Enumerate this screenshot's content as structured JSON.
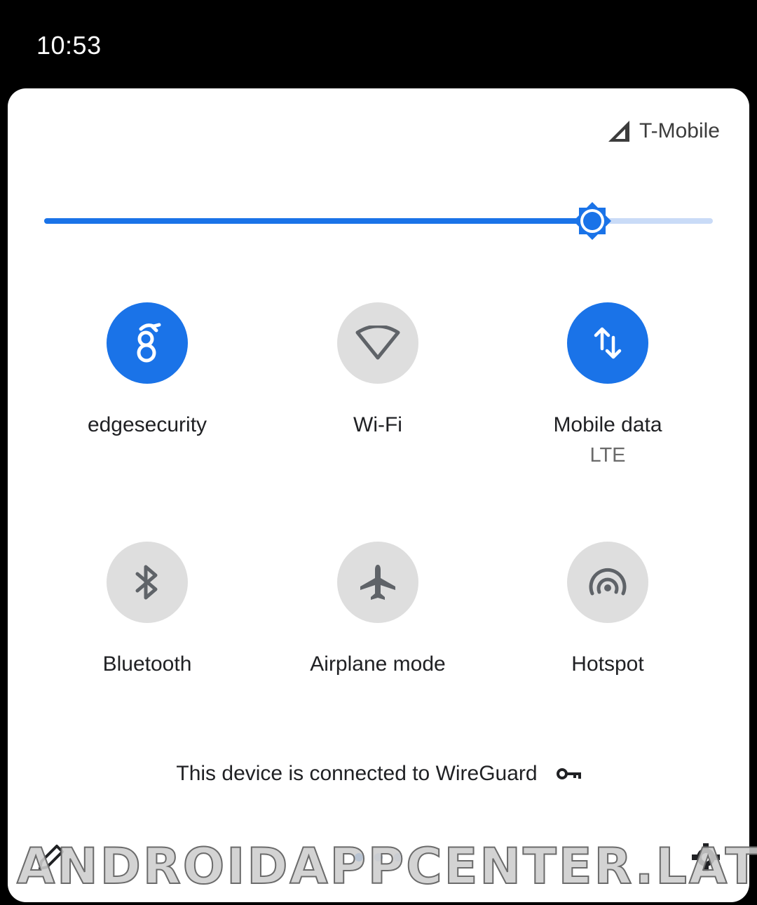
{
  "status_bar": {
    "time": "10:53"
  },
  "carrier": {
    "name": "T-Mobile"
  },
  "brightness": {
    "level": 0.82,
    "accent": "#1a73e8",
    "track_color": "#c9dbf7"
  },
  "tiles": [
    {
      "label": "edgesecurity",
      "icon": "wireguard-dragon-icon",
      "active": true
    },
    {
      "label": "Wi-Fi",
      "icon": "wifi-icon",
      "active": false
    },
    {
      "label": "Mobile data",
      "sublabel": "LTE",
      "icon": "mobile-data-icon",
      "active": true
    },
    {
      "label": "Bluetooth",
      "icon": "bluetooth-icon",
      "active": false
    },
    {
      "label": "Airplane mode",
      "icon": "airplane-icon",
      "active": false
    },
    {
      "label": "Hotspot",
      "icon": "hotspot-icon",
      "active": false
    }
  ],
  "vpn_notice": {
    "text": "This device is connected to WireGuard",
    "icon": "vpn-key-icon"
  },
  "pager": {
    "pages": 3,
    "current": 0
  },
  "footer": {
    "edit_icon": "pencil-icon",
    "settings_icon": "gear-icon"
  },
  "watermark": {
    "text": "ANDROIDAPPCENTER.LAT"
  },
  "colors": {
    "tile_on": "#1a73e8",
    "tile_off": "#dedede",
    "panel": "#ffffff",
    "background": "#000000"
  }
}
